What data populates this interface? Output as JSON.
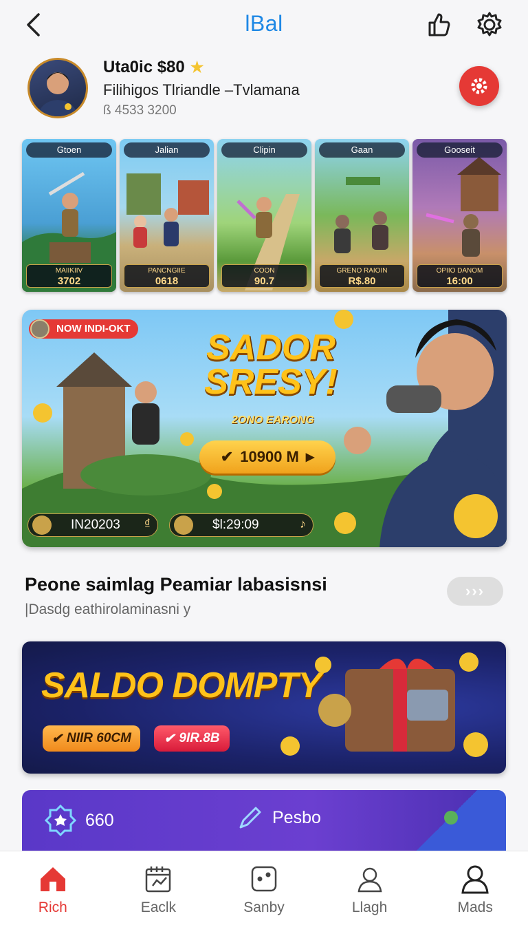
{
  "header": {
    "title": "lBal",
    "back_icon": "chevron-left-icon",
    "icons": [
      "like-icon",
      "settings-icon"
    ]
  },
  "profile": {
    "name": "Uta0ic $80",
    "subtitle": "Filihigos Tlriandle –Tvlamana",
    "id_text": "ß 4533 3200"
  },
  "game_cards": [
    {
      "title": "Gtoen",
      "label": "MAIIKIIV",
      "value": "3702"
    },
    {
      "title": "Jalian",
      "label": "PANCNGIIE",
      "value": "0618"
    },
    {
      "title": "Clipin",
      "label": "COON",
      "value": "90.7"
    },
    {
      "title": "Gaan",
      "label": "GRENO RAIOIN",
      "value": "R$.80"
    },
    {
      "title": "Gooseit",
      "label": "OPIIO DANOM",
      "value": "16:00"
    }
  ],
  "hero": {
    "badge": "NOW INDI-OKT",
    "title_line1": "SADOR",
    "title_line2": "SRESY!",
    "subtitle": "2ONO EARONG",
    "cta": "10900 M",
    "pill1": "IN20203",
    "pill2": "$l:29:09"
  },
  "section": {
    "title": "Peone saimlag Peamiar labasisnsi",
    "subtitle": "|Dasdg eathirolaminasni y",
    "more": "›››"
  },
  "promo": {
    "title": "SALDO DOMPTY",
    "btn1": "NIIR 60CM",
    "btn2": "9IR.8B"
  },
  "stats": {
    "stat1": "660",
    "stat2": "Pesbo"
  },
  "bottom_nav": [
    {
      "label": "Rich",
      "icon": "home-icon",
      "active": true
    },
    {
      "label": "Eaclk",
      "icon": "calendar-icon",
      "active": false
    },
    {
      "label": "Sanby",
      "icon": "dice-icon",
      "active": false
    },
    {
      "label": "Llagh",
      "icon": "user-icon",
      "active": false
    },
    {
      "label": "Mads",
      "icon": "profile-icon",
      "active": false
    }
  ],
  "colors": {
    "accent": "#1e88e5",
    "primary_red": "#e53935",
    "gold": "#ffc21a",
    "purple": "#5a38c8"
  }
}
